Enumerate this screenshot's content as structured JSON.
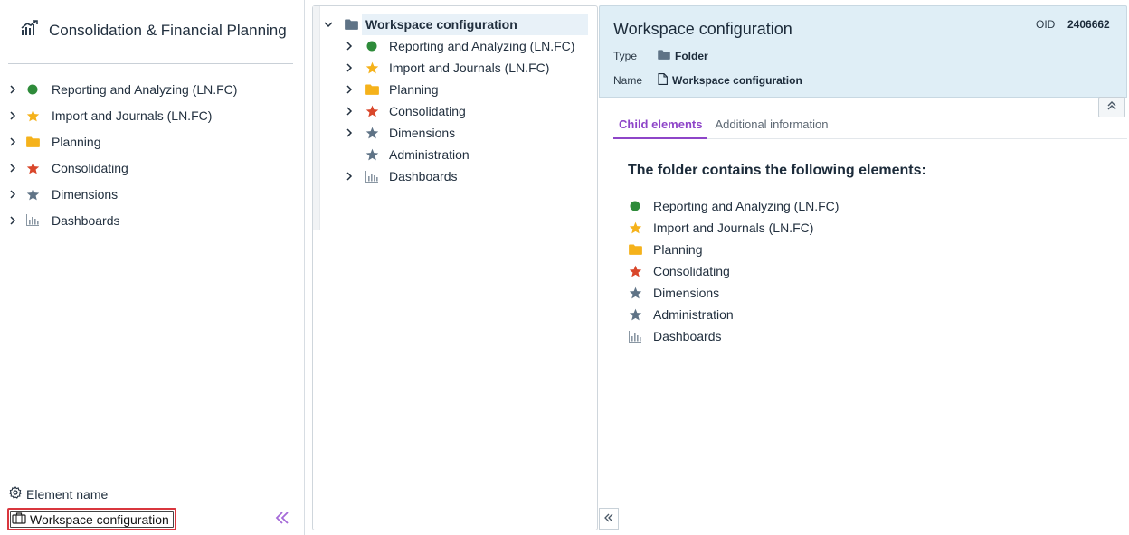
{
  "app": {
    "title": "Consolidation & Financial Planning"
  },
  "colors": {
    "green": "#2e8b3a",
    "yellow": "#f5b21b",
    "folder": "#f5b21b",
    "red": "#d9472b",
    "slate": "#5f7386",
    "accent": "#8e45c8",
    "highlight": "#d9363e"
  },
  "sidebar": {
    "items": [
      {
        "label": "Reporting and Analyzing (LN.FC)",
        "icon": "green-dot-icon"
      },
      {
        "label": "Import and Journals (LN.FC)",
        "icon": "yellow-star-icon"
      },
      {
        "label": "Planning",
        "icon": "folder-icon"
      },
      {
        "label": "Consolidating",
        "icon": "red-star-icon"
      },
      {
        "label": "Dimensions",
        "icon": "slate-star-icon"
      },
      {
        "label": "Dashboards",
        "icon": "dashboard-icon"
      }
    ],
    "element_name_label": "Element name",
    "workspace_button": "Workspace configuration"
  },
  "tree": {
    "root": "Workspace configuration",
    "children": [
      {
        "label": "Reporting and Analyzing (LN.FC)",
        "icon": "green-dot-icon",
        "expandable": true
      },
      {
        "label": "Import and Journals (LN.FC)",
        "icon": "yellow-star-icon",
        "expandable": true
      },
      {
        "label": "Planning",
        "icon": "folder-icon",
        "expandable": true
      },
      {
        "label": "Consolidating",
        "icon": "red-star-icon",
        "expandable": true
      },
      {
        "label": "Dimensions",
        "icon": "slate-star-icon",
        "expandable": true
      },
      {
        "label": "Administration",
        "icon": "slate-star-icon",
        "expandable": false
      },
      {
        "label": "Dashboards",
        "icon": "dashboard-icon",
        "expandable": true
      }
    ]
  },
  "detail": {
    "title": "Workspace configuration",
    "oid_label": "OID",
    "oid_value": "2406662",
    "type_label": "Type",
    "type_value": "Folder",
    "name_label": "Name",
    "name_value": "Workspace configuration",
    "tabs": [
      "Child elements",
      "Additional information"
    ],
    "contains_title": "The folder contains the following elements:",
    "children": [
      {
        "label": "Reporting and Analyzing (LN.FC)",
        "icon": "green-dot-icon"
      },
      {
        "label": "Import and Journals (LN.FC)",
        "icon": "yellow-star-icon"
      },
      {
        "label": "Planning",
        "icon": "folder-icon"
      },
      {
        "label": "Consolidating",
        "icon": "red-star-icon"
      },
      {
        "label": "Dimensions",
        "icon": "slate-star-icon"
      },
      {
        "label": "Administration",
        "icon": "slate-star-icon"
      },
      {
        "label": "Dashboards",
        "icon": "dashboard-icon"
      }
    ]
  }
}
